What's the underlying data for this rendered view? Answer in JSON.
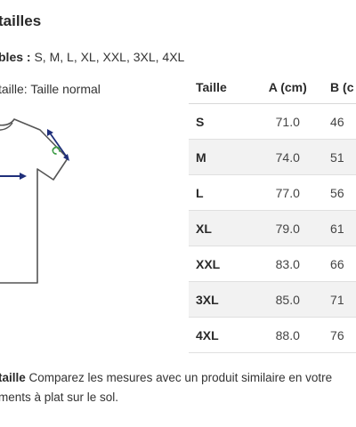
{
  "heading": "tailles",
  "available": {
    "label": "bles :",
    "values": "S, M, L, XL, XXL, 3XL, 4XL"
  },
  "fit": "taille: Taille normal",
  "diagram": {
    "label_c": "C"
  },
  "table": {
    "headers": [
      "Taille",
      "A (cm)",
      "B (c"
    ],
    "rows": [
      [
        "S",
        "71.0",
        "46"
      ],
      [
        "M",
        "74.0",
        "51"
      ],
      [
        "L",
        "77.0",
        "56"
      ],
      [
        "XL",
        "79.0",
        "61"
      ],
      [
        "XXL",
        "83.0",
        "66"
      ],
      [
        "3XL",
        "85.0",
        "71"
      ],
      [
        "4XL",
        "88.0",
        "76"
      ]
    ]
  },
  "note": {
    "bold": "taille",
    "line1": " Comparez les mesures avec un produit similaire en votre",
    "line2": "ments à plat sur le sol."
  },
  "colors": {
    "arrow": "#1f2f7a",
    "accent_c": "#3e9c47",
    "text": "#333333",
    "row_stripe": "#f2f2f2"
  }
}
